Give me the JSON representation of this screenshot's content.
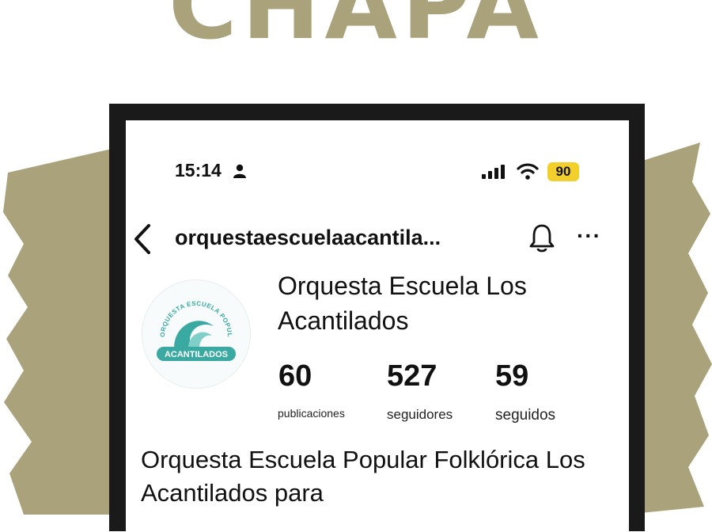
{
  "headline": "CHAPA",
  "colors": {
    "olive_accent": "#a9a27a",
    "frame": "#1a1a1a",
    "purple_edge": "#6a3fc2",
    "battery": "#f2cf2a",
    "logo_teal": "#3aa9a2"
  },
  "status_bar": {
    "time": "15:14",
    "person_icon": "person-icon",
    "signal_icon": "signal-bars-icon",
    "wifi_icon": "wifi-icon",
    "battery_level": "90"
  },
  "nav": {
    "back_icon": "chevron-left-icon",
    "username": "orquestaescuelaacantila...",
    "bell_icon": "bell-icon",
    "more_label": "···"
  },
  "profile": {
    "avatar": {
      "logo_arc_text": "ORQUESTA ESCUELA POPULAR FOLKLÓRICA",
      "logo_banner": "ACANTILADOS"
    },
    "display_name": "Orquesta Escuela Los Acantilados",
    "stats": [
      {
        "value": "60",
        "label": "publicaciones"
      },
      {
        "value": "527",
        "label": "seguidores"
      },
      {
        "value": "59",
        "label": "seguidos"
      }
    ],
    "bio": "Orquesta Escuela Popular Folklórica Los Acantilados para"
  }
}
